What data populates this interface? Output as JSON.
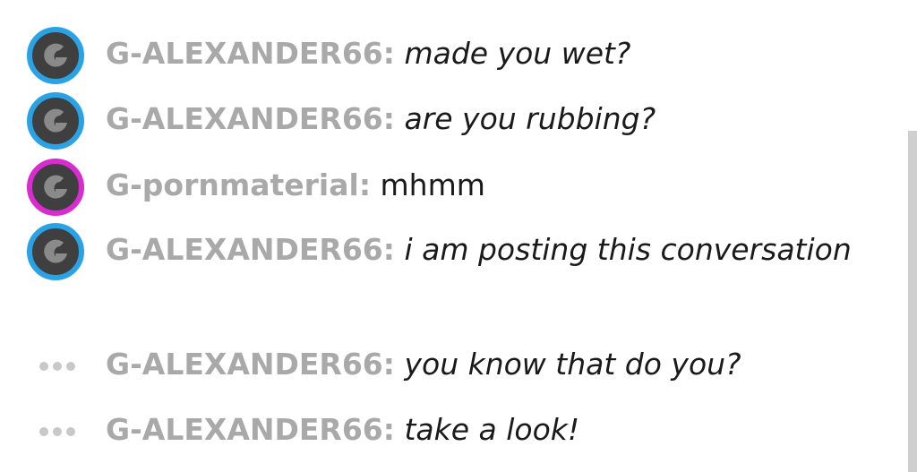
{
  "chat": {
    "cut_off_text": "",
    "messages": [
      {
        "username": "G-ALEXANDER66:",
        "text": "made you wet?",
        "avatar_letter": "G",
        "avatar_ring_color": "#29a3e6"
      },
      {
        "username": "G-ALEXANDER66:",
        "text": "are you rubbing?",
        "avatar_letter": "G",
        "avatar_ring_color": "#29a3e6"
      },
      {
        "username": "G-pornmaterial:",
        "text": "mhmm",
        "avatar_letter": "G",
        "avatar_ring_color": "#d92bd0"
      },
      {
        "username": "G-ALEXANDER66:",
        "text": "i am posting this conversation",
        "avatar_letter": "G",
        "avatar_ring_color": "#29a3e6"
      },
      {
        "username": "G-ALEXANDER66:",
        "text": "you know that do you?",
        "indicator": "typing-dots-icon"
      },
      {
        "username": "G-ALEXANDER66:",
        "text": "take a look!",
        "indicator": "typing-dots-icon"
      }
    ]
  },
  "colors": {
    "username": "#a9a9a9",
    "message_text": "#1a1a1a",
    "avatar_bg": "#3f3f3f",
    "avatar_letter": "#8a8a8a",
    "dots": "#c8c8c8",
    "scrollbar": "#cfcfcf"
  }
}
